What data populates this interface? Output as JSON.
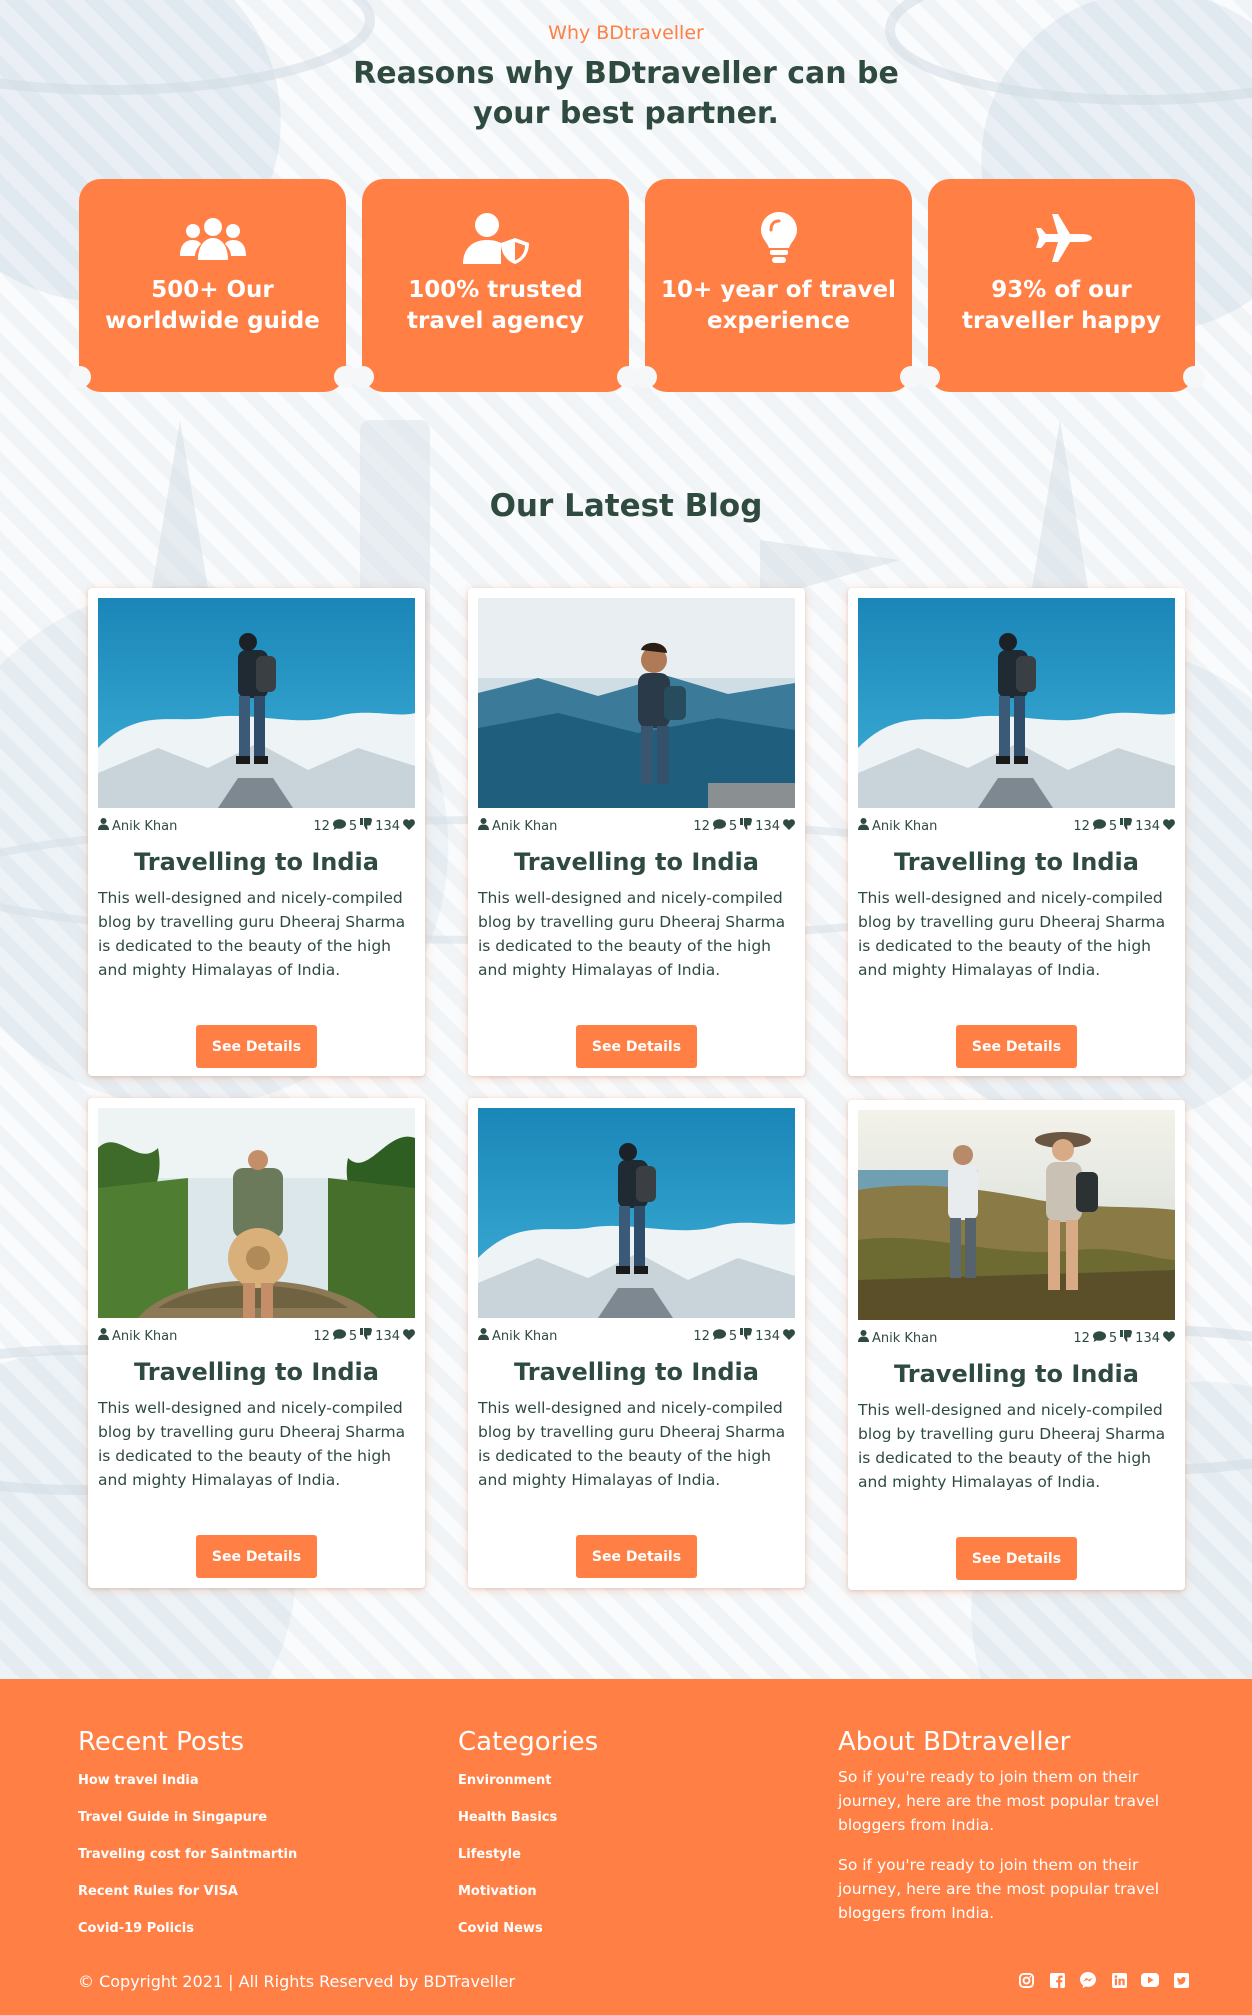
{
  "why": {
    "eyebrow": "Why BDtraveller",
    "title": "Reasons why BDtraveller can be your best partner.",
    "features": [
      {
        "icon": "users-icon",
        "text": "500+ Our worldwide guide"
      },
      {
        "icon": "user-shield-icon",
        "text": "100% trusted travel agency"
      },
      {
        "icon": "lightbulb-icon",
        "text": "10+ year of travel experience"
      },
      {
        "icon": "airplane-icon",
        "text": "93% of our traveller happy"
      }
    ]
  },
  "blog": {
    "title": "Our Latest Blog",
    "posts": [
      {
        "image": "hiker-on-snowy-mountain",
        "author": "Anik Khan",
        "comments": "12",
        "dislikes": "5",
        "likes": "134",
        "title": "Travelling to India",
        "desc": "This well-designed and nicely-compiled blog by travelling guru Dheeraj Sharma is dedicated to the beauty of the high and mighty Himalayas of India.",
        "button": "See Details"
      },
      {
        "image": "man-on-mountain-lake",
        "author": "Anik Khan",
        "comments": "12",
        "dislikes": "5",
        "likes": "134",
        "title": "Travelling to India",
        "desc": "This well-designed and nicely-compiled blog by travelling guru Dheeraj Sharma is dedicated to the beauty of the high and mighty Himalayas of India.",
        "button": "See Details"
      },
      {
        "image": "hiker-on-snowy-mountain",
        "author": "Anik Khan",
        "comments": "12",
        "dislikes": "5",
        "likes": "134",
        "title": "Travelling to India",
        "desc": "This well-designed and nicely-compiled blog by travelling guru Dheeraj Sharma is dedicated to the beauty of the high and mighty Himalayas of India.",
        "button": "See Details"
      },
      {
        "image": "backpacker-in-jungle",
        "author": "Anik Khan",
        "comments": "12",
        "dislikes": "5",
        "likes": "134",
        "title": "Travelling to India",
        "desc": "This well-designed and nicely-compiled blog by travelling guru Dheeraj Sharma is dedicated to the beauty of the high and mighty Himalayas of India.",
        "button": "See Details"
      },
      {
        "image": "hiker-on-snowy-mountain",
        "author": "Anik Khan",
        "comments": "12",
        "dislikes": "5",
        "likes": "134",
        "title": "Travelling to India",
        "desc": "This well-designed and nicely-compiled blog by travelling guru Dheeraj Sharma is dedicated to the beauty of the high and mighty Himalayas of India.",
        "button": "See Details"
      },
      {
        "image": "couple-hiking-coast",
        "author": "Anik Khan",
        "comments": "12",
        "dislikes": "5",
        "likes": "134",
        "title": "Travelling to India",
        "desc": "This well-designed and nicely-compiled blog by travelling guru Dheeraj Sharma is dedicated to the beauty of the high and mighty Himalayas of India.",
        "button": "See Details"
      }
    ]
  },
  "footer": {
    "recent": {
      "title": "Recent Posts",
      "items": [
        "How travel India",
        "Travel Guide in Singapure",
        "Traveling cost for Saintmartin",
        "Recent Rules for VISA",
        "Covid-19 Policis"
      ]
    },
    "categories": {
      "title": "Categories",
      "items": [
        "Environment",
        "Health Basics",
        "Lifestyle",
        "Motivation",
        "Covid News"
      ]
    },
    "about": {
      "title": "About BDtraveller",
      "paragraphs": [
        "So if you're ready to join them on their journey, here are the most popular travel bloggers from India.",
        "So if you're ready to join them on their journey, here are the most popular travel bloggers from India."
      ]
    },
    "copyright": "© Copyright 2021 | All Rights Reserved by BDTraveller",
    "socials": [
      "instagram-icon",
      "facebook-icon",
      "messenger-icon",
      "linkedin-icon",
      "youtube-icon",
      "twitter-icon"
    ]
  },
  "colors": {
    "accent": "#ff7f45",
    "heading": "#2f4a3e",
    "background": "#f7f9fb"
  }
}
